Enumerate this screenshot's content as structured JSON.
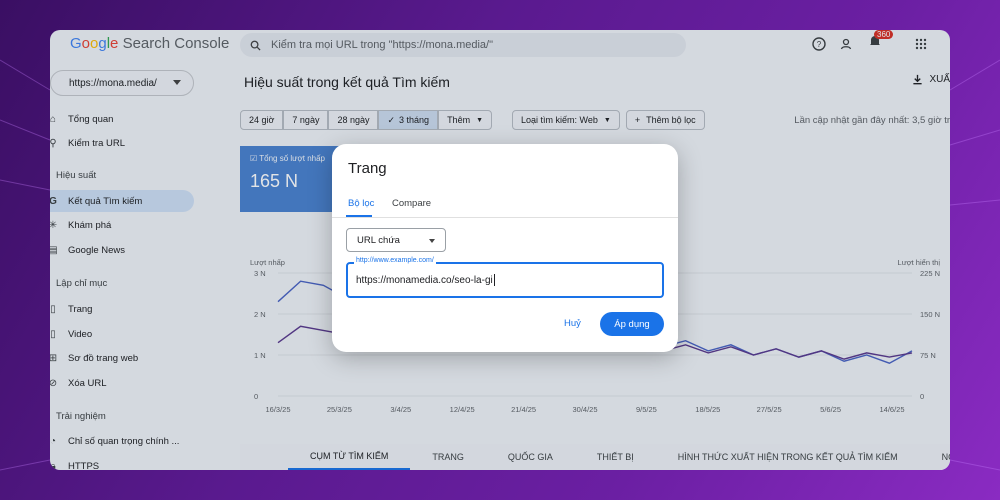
{
  "app": {
    "logo_google": "Google",
    "logo_product": "Search Console",
    "search_placeholder": "Kiểm tra mọi URL trong \"https://mona.media/\"",
    "notification_count": "360"
  },
  "sidebar": {
    "property": "https://mona.media/",
    "items": [
      {
        "label": "Tổng quan",
        "icon": "home-icon"
      },
      {
        "label": "Kiểm tra URL",
        "icon": "search-icon"
      }
    ],
    "section_performance": "Hiệu suất",
    "performance_items": [
      {
        "label": "Kết quả Tìm kiếm",
        "icon": "google-g-icon",
        "active": true
      },
      {
        "label": "Khám phá",
        "icon": "asterisk-icon"
      },
      {
        "label": "Google News",
        "icon": "news-icon"
      }
    ],
    "section_index": "Lập chỉ mục",
    "index_items": [
      {
        "label": "Trang",
        "icon": "page-icon"
      },
      {
        "label": "Video",
        "icon": "video-page-icon"
      },
      {
        "label": "Sơ đồ trang web",
        "icon": "sitemap-icon"
      },
      {
        "label": "Xóa URL",
        "icon": "remove-url-icon"
      }
    ],
    "section_experience": "Trải nghiệm",
    "experience_items": [
      {
        "label": "Chỉ số quan trọng chính ...",
        "icon": "gauge-icon"
      },
      {
        "label": "HTTPS",
        "icon": "lock-icon"
      }
    ]
  },
  "main": {
    "title": "Hiệu suất trong kết quả Tìm kiếm",
    "export_label": "XUẤ",
    "date_chips": [
      "24 giờ",
      "7 ngày",
      "28 ngày",
      "3 tháng",
      "Thêm"
    ],
    "selected_chip": "3 tháng",
    "search_type_chip": "Loại tìm kiếm: Web",
    "add_filter_chip": "Thêm bộ lọc",
    "last_updated": "Lần cập nhật gần đây nhất: 3,5 giờ tr",
    "metric_label": "Tổng số lượt nhấp",
    "metric_value": "165 N"
  },
  "chart_data": {
    "type": "line",
    "ylabel_left": "Lượt nhấp",
    "ylabel_right": "Lượt hiển thị",
    "y_ticks_left": [
      "3 N",
      "2 N",
      "1 N",
      "0"
    ],
    "y_ticks_right": [
      "225 N",
      "150 N",
      "75 N",
      "0"
    ],
    "ylim_left": [
      0,
      3000
    ],
    "ylim_right": [
      0,
      225000
    ],
    "x_labels": [
      "16/3/25",
      "25/3/25",
      "3/4/25",
      "12/4/25",
      "21/4/25",
      "30/4/25",
      "9/5/25",
      "18/5/25",
      "27/5/25",
      "5/6/25",
      "14/6/25"
    ],
    "grid": true,
    "series": [
      {
        "color": "#4a63c4",
        "values": [
          2300,
          2800,
          2700,
          2400,
          2100,
          1700,
          2200,
          2600,
          1900,
          1600,
          1800,
          1500,
          1650,
          1400,
          1550,
          1300,
          1450,
          1200,
          1350,
          1100,
          1250,
          1000,
          1150,
          950,
          1100,
          850,
          1000,
          800,
          1100
        ]
      },
      {
        "color": "#5b3a8e",
        "values": [
          1300,
          1700,
          1600,
          1500,
          1200,
          1500,
          1450,
          1600,
          1350,
          1300,
          1500,
          1250,
          1400,
          1200,
          1350,
          1150,
          1300,
          1100,
          1250,
          1050,
          1200,
          1000,
          1150,
          950,
          1100,
          900,
          1050,
          950,
          1050
        ]
      }
    ]
  },
  "bottom_tabs": [
    "CỤM TỪ TÌM KIẾM",
    "TRANG",
    "QUỐC GIA",
    "THIẾT BỊ",
    "HÌNH THỨC XUẤT HIỆN TRONG KẾT QUẢ TÌM KIẾM",
    "NGÀY"
  ],
  "dialog": {
    "title": "Trang",
    "tab_filter": "Bộ lọc",
    "tab_compare": "Compare",
    "match_type": "URL chứa",
    "url_label": "http://www.example.com/",
    "url_value": "https://monamedia.co/seo-la-gi",
    "cancel": "Huỷ",
    "apply": "Áp dụng"
  }
}
